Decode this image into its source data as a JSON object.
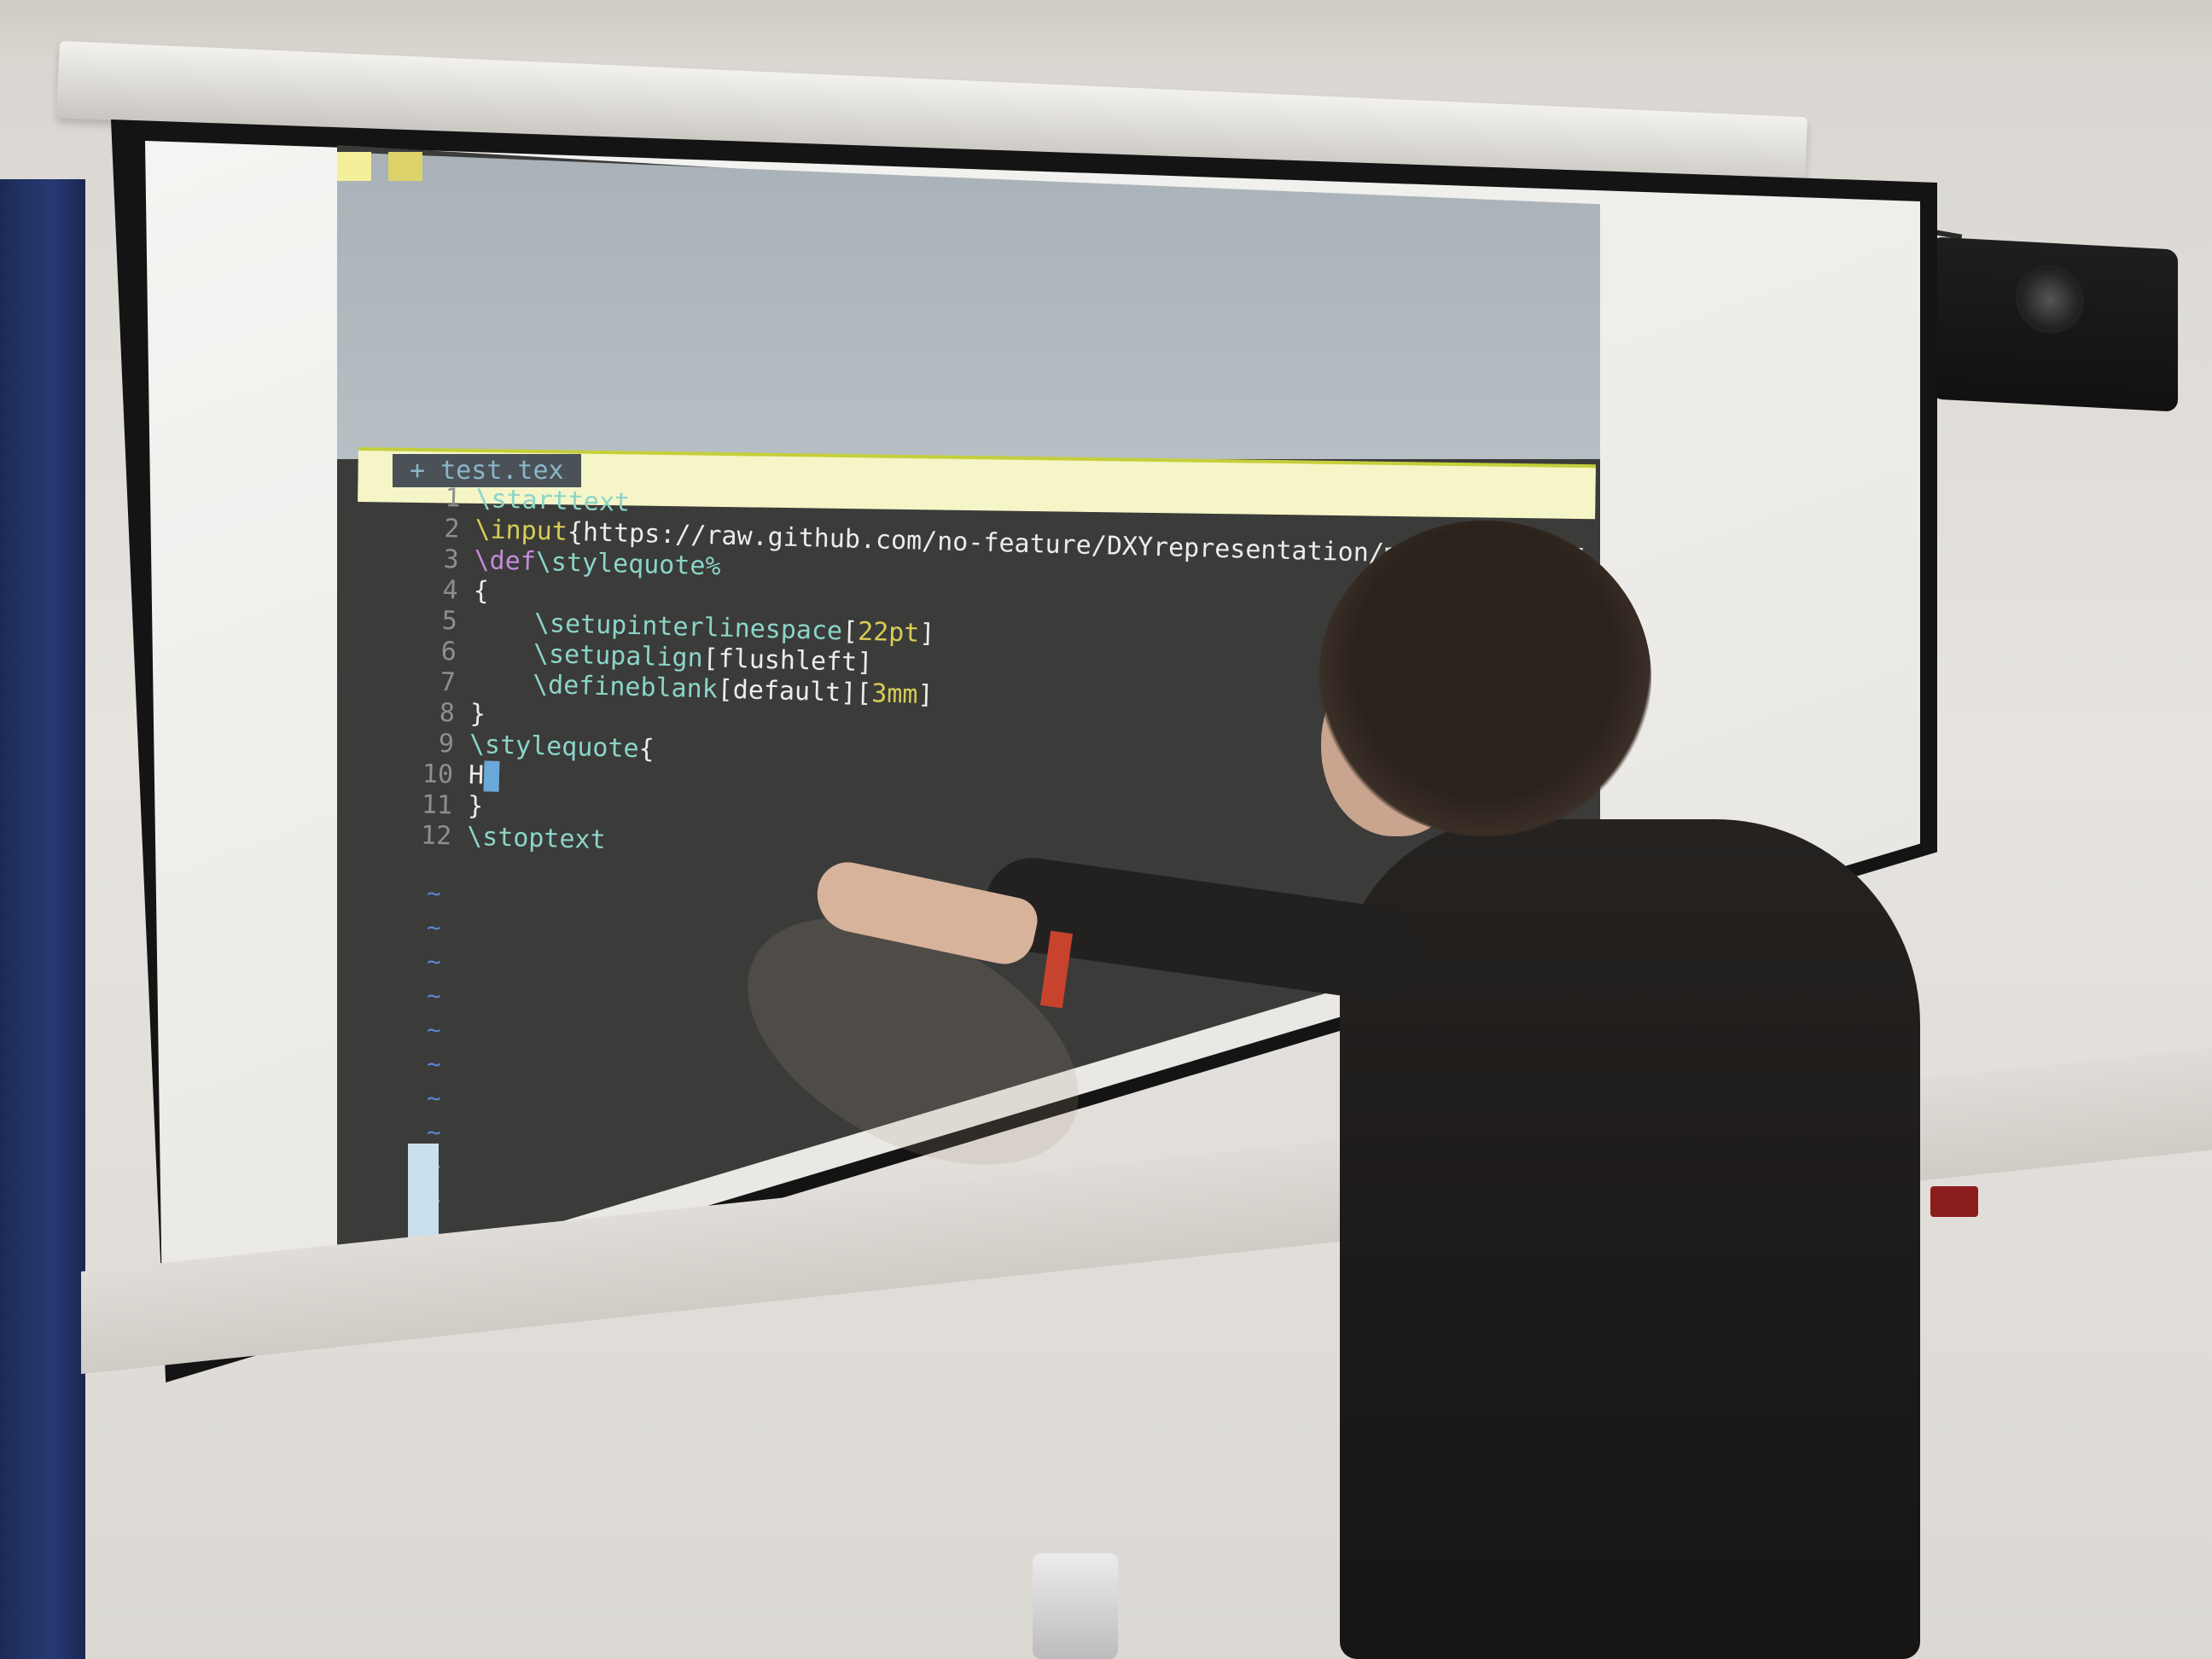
{
  "editor": {
    "tabs": [
      "",
      ""
    ],
    "file_tab": "+ test.tex",
    "lines": [
      {
        "num": "1",
        "segments": [
          {
            "cls": "kw",
            "text": "\\starttext"
          }
        ]
      },
      {
        "num": "2",
        "segments": [
          {
            "cls": "num",
            "text": "\\input"
          },
          {
            "cls": "txt",
            "text": "{https://raw.github.com/no-feature/DXYrepresentation/master/README"
          }
        ]
      },
      {
        "num": "3",
        "segments": [
          {
            "cls": "def",
            "text": "\\def"
          },
          {
            "cls": "kw",
            "text": "\\stylequote%"
          }
        ]
      },
      {
        "num": "4",
        "segments": [
          {
            "cls": "txt",
            "text": "{"
          }
        ]
      },
      {
        "num": "5",
        "segments": [
          {
            "cls": "kw",
            "text": "    \\setupinterlinespace"
          },
          {
            "cls": "txt",
            "text": "["
          },
          {
            "cls": "num",
            "text": "22pt"
          },
          {
            "cls": "txt",
            "text": "]"
          }
        ]
      },
      {
        "num": "6",
        "segments": [
          {
            "cls": "kw",
            "text": "    \\setupalign"
          },
          {
            "cls": "txt",
            "text": "[flushleft]"
          }
        ]
      },
      {
        "num": "7",
        "segments": [
          {
            "cls": "kw",
            "text": "    \\defineblank"
          },
          {
            "cls": "txt",
            "text": "[default]["
          },
          {
            "cls": "num",
            "text": "3mm"
          },
          {
            "cls": "txt",
            "text": "]"
          }
        ]
      },
      {
        "num": "8",
        "segments": [
          {
            "cls": "txt",
            "text": "}"
          }
        ]
      },
      {
        "num": "9",
        "segments": [
          {
            "cls": "kw",
            "text": "\\stylequote"
          },
          {
            "cls": "txt",
            "text": "{"
          }
        ]
      },
      {
        "num": "10",
        "segments": [
          {
            "cls": "txt",
            "text": "H"
          },
          {
            "cls": "cursor",
            "text": " "
          }
        ]
      },
      {
        "num": "11",
        "segments": [
          {
            "cls": "txt",
            "text": "}"
          }
        ]
      },
      {
        "num": "12",
        "segments": [
          {
            "cls": "kw",
            "text": "\\stoptext"
          }
        ]
      }
    ],
    "tildes": [
      "~",
      "~",
      "~",
      "~",
      "~",
      "~",
      "~",
      "~",
      "~",
      "~",
      "~",
      "~"
    ]
  },
  "colors": {
    "editor_bg": "#3b3b3a",
    "keyword": "#8bd5c9",
    "def": "#c48bd8",
    "number": "#d8cc55",
    "text": "#ececec",
    "status_bar": "#f5f5c7"
  }
}
